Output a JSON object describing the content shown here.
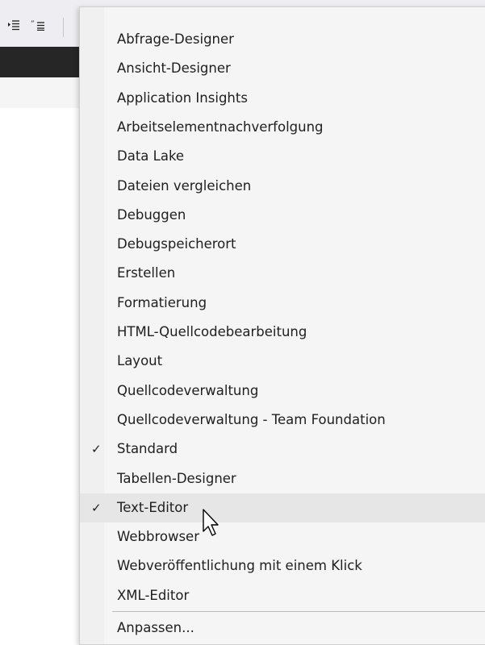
{
  "menu": {
    "items": [
      {
        "label": "Abfrage-Designer",
        "checked": false
      },
      {
        "label": "Ansicht-Designer",
        "checked": false
      },
      {
        "label": "Application Insights",
        "checked": false
      },
      {
        "label": "Arbeitselementnachverfolgung",
        "checked": false
      },
      {
        "label": "Data Lake",
        "checked": false
      },
      {
        "label": "Dateien vergleichen",
        "checked": false
      },
      {
        "label": "Debuggen",
        "checked": false
      },
      {
        "label": "Debugspeicherort",
        "checked": false
      },
      {
        "label": "Erstellen",
        "checked": false
      },
      {
        "label": "Formatierung",
        "checked": false
      },
      {
        "label": "HTML-Quellcodebearbeitung",
        "checked": false
      },
      {
        "label": "Layout",
        "checked": false
      },
      {
        "label": "Quellcodeverwaltung",
        "checked": false
      },
      {
        "label": "Quellcodeverwaltung - Team Foundation",
        "checked": false
      },
      {
        "label": "Standard",
        "checked": true
      },
      {
        "label": "Tabellen-Designer",
        "checked": false
      },
      {
        "label": "Text-Editor",
        "checked": true,
        "hovered": true
      },
      {
        "label": "Webbrowser",
        "checked": false
      },
      {
        "label": "Webveröffentlichung mit einem Klick",
        "checked": false
      },
      {
        "label": "XML-Editor",
        "checked": false
      }
    ],
    "customize_label": "Anpassen...",
    "check_glyph": "✓"
  },
  "toolbar": {
    "icons": [
      "indent-icon",
      "comment-icon",
      "menu-icon"
    ]
  },
  "colors": {
    "menu_background": "#f5f5f5",
    "hover_background": "#e6e6e6",
    "text": "#1e1e1e",
    "dark_bar": "#262626"
  }
}
